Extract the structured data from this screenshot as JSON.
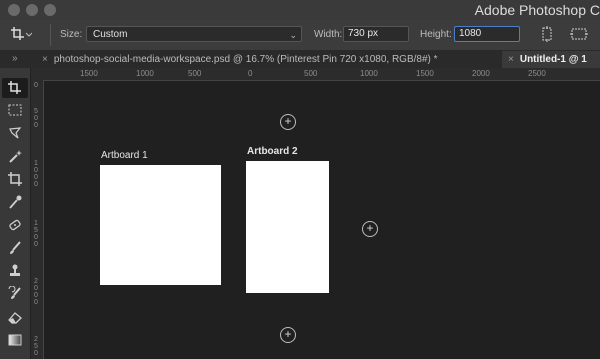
{
  "app": {
    "title": "Adobe Photoshop C"
  },
  "options_bar": {
    "size_label": "Size:",
    "size_value": "Custom",
    "width_label": "Width:",
    "width_value": "730 px",
    "height_label": "Height:",
    "height_value": "1080"
  },
  "tabs": [
    {
      "label": "photoshop-social-media-workspace.psd @ 16.7% (Pinterest Pin 720 x1080, RGB/8#) *",
      "close": "×"
    },
    {
      "label": "Untitled-1 @ 1",
      "close": "×"
    }
  ],
  "ruler": {
    "h_ticks": [
      "1500",
      "1000",
      "500",
      "0",
      "500",
      "1000",
      "1500",
      "2000",
      "2500"
    ],
    "v_ticks": [
      "0",
      "5 0 0",
      "1 0 0 0",
      "1 5 0 0",
      "2 0 0 0",
      "2 5 0"
    ]
  },
  "artboards": [
    {
      "label": "Artboard 1"
    },
    {
      "label": "Artboard 2"
    }
  ],
  "add_artboard_symbol": "+",
  "tools": [
    "artboard-tool-icon",
    "marquee-tool-icon",
    "lasso-tool-icon",
    "magic-wand-icon",
    "crop-tool-icon",
    "eyedropper-icon",
    "healing-brush-icon",
    "brush-icon",
    "clone-stamp-icon",
    "history-brush-icon",
    "eraser-icon",
    "gradient-icon"
  ],
  "colors": {
    "accent": "#4a7fc7",
    "canvas": "#202020",
    "artboard": "#ffffff"
  }
}
